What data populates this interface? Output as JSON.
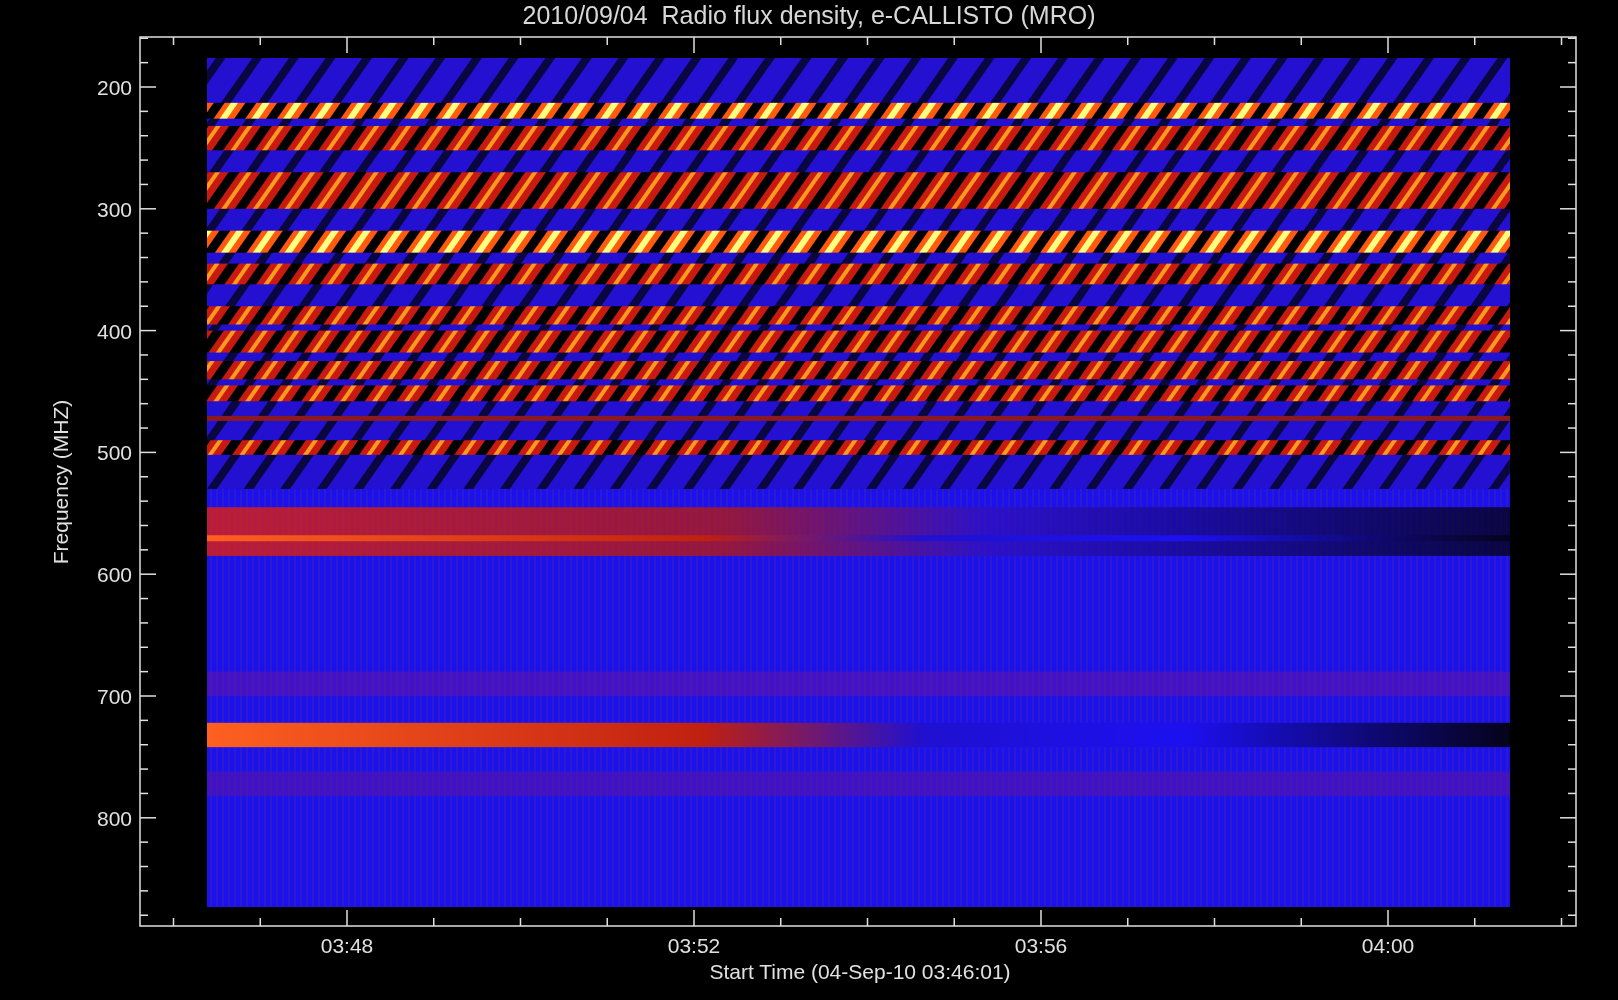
{
  "title": "2010/09/04  Radio flux density, e-CALLISTO (MRO)",
  "y_axis": {
    "label": "Frequency (MHZ)",
    "ticks": [
      "200",
      "300",
      "400",
      "500",
      "600",
      "700",
      "800"
    ]
  },
  "x_axis": {
    "label": "Start Time (04-Sep-10 03:46:01)",
    "ticks": [
      "03:48",
      "03:52",
      "03:56",
      "04:00"
    ]
  }
}
